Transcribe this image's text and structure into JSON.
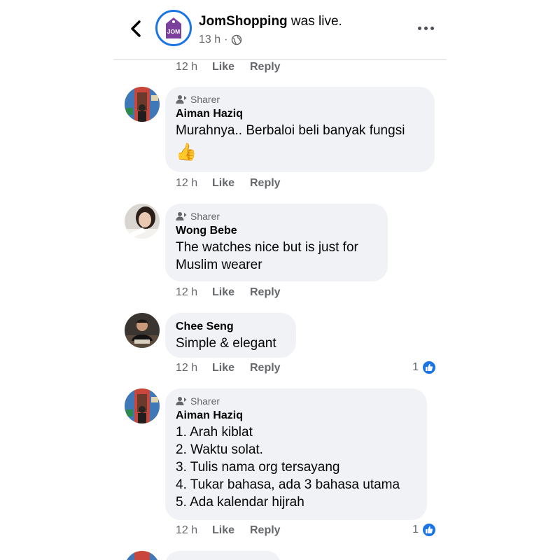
{
  "header": {
    "page_name": "JomShopping",
    "action_text": " was live.",
    "time": "13 h",
    "separator": "·",
    "avatar_text": "JOM"
  },
  "top_meta": {
    "time": "12 h",
    "like": "Like",
    "reply": "Reply"
  },
  "comments": [
    {
      "badge": "Sharer",
      "author": "Aiman Haziq",
      "text": "Murahnya.. Berbaloi beli banyak fungsi",
      "emoji": "👍",
      "meta": {
        "time": "12 h",
        "like": "Like",
        "reply": "Reply"
      }
    },
    {
      "badge": "Sharer",
      "author": "Wong Bebe",
      "lines": [
        "The watches nice but is just for",
        "Muslim wearer"
      ],
      "meta": {
        "time": "12 h",
        "like": "Like",
        "reply": "Reply"
      }
    },
    {
      "author": "Chee Seng",
      "text": "Simple & elegant",
      "meta": {
        "time": "12 h",
        "like": "Like",
        "reply": "Reply"
      },
      "reactions": "1"
    },
    {
      "badge": "Sharer",
      "author": "Aiman Haziq",
      "lines": [
        "1. Arah kiblat",
        "2. Waktu solat.",
        "3. Tulis nama org tersayang",
        "4. Tukar bahasa, ada 3 bahasa utama",
        "5. Ada kalendar hijrah"
      ],
      "meta": {
        "time": "12 h",
        "like": "Like",
        "reply": "Reply"
      },
      "reactions": "1"
    }
  ],
  "colors": {
    "accent": "#1b74e4",
    "bubble": "#f0f2f5",
    "muted": "#65676b"
  }
}
